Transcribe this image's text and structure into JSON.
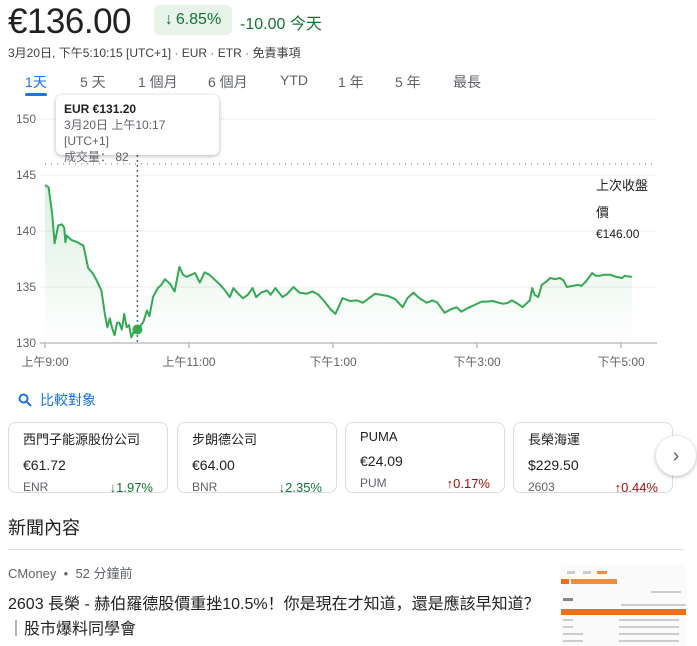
{
  "header": {
    "price": "€136.00",
    "change_pct": "6.85%",
    "change_abs": "-10.00",
    "change_period": "今天",
    "arrow_icon": "arrow-down-icon",
    "timestamp": "3月20日, 下午5:10:15 [UTC+1]",
    "currency": "EUR",
    "exchange": "ETR",
    "disclaimer": "免責事項"
  },
  "tabs": [
    "1天",
    "5 天",
    "1 個月",
    "6 個月",
    "YTD",
    "1 年",
    "5 年",
    "最長"
  ],
  "tooltip": {
    "price": "EUR €131.20",
    "time": "3月20日 上午10:17 [UTC+1]",
    "volume_label": "成交量：",
    "volume": "82"
  },
  "prev_close": {
    "label_1": "上次收盤",
    "label_2": "價",
    "value": "€146.00"
  },
  "colors": {
    "up": "#a50e0e",
    "down": "#137333",
    "line": "#34a853",
    "accent": "#1a73e8"
  },
  "chart_data": {
    "type": "line",
    "x_unit": "minutes since 09:00",
    "xlim": [
      0,
      510
    ],
    "ylim": [
      130,
      150
    ],
    "yticks": [
      150,
      145,
      140,
      135,
      130
    ],
    "xticks": [
      {
        "t": 0,
        "label": "上午9:00"
      },
      {
        "t": 120,
        "label": "上午11:00"
      },
      {
        "t": 240,
        "label": "下午1:00"
      },
      {
        "t": 360,
        "label": "下午3:00"
      },
      {
        "t": 480,
        "label": "下午5:00"
      }
    ],
    "previous_close": 146.0,
    "highlight": {
      "t": 77,
      "price": 131.2
    },
    "points": [
      [
        0,
        144.1
      ],
      [
        3,
        143.9
      ],
      [
        6,
        141.5
      ],
      [
        8,
        138.9
      ],
      [
        11,
        140.5
      ],
      [
        14,
        140.6
      ],
      [
        16,
        140.3
      ],
      [
        17,
        139.0
      ],
      [
        18,
        139.6
      ],
      [
        22,
        139.2
      ],
      [
        27,
        139.0
      ],
      [
        32,
        138.7
      ],
      [
        36,
        136.7
      ],
      [
        40,
        136.2
      ],
      [
        43,
        135.6
      ],
      [
        47,
        134.7
      ],
      [
        50,
        132.5
      ],
      [
        52,
        131.4
      ],
      [
        54,
        132.2
      ],
      [
        56,
        131.3
      ],
      [
        58,
        130.7
      ],
      [
        60,
        131.8
      ],
      [
        62,
        131.8
      ],
      [
        64,
        131.2
      ],
      [
        66,
        132.6
      ],
      [
        68,
        131.4
      ],
      [
        70,
        131.6
      ],
      [
        72,
        130.5
      ],
      [
        75,
        131.3
      ],
      [
        77,
        131.2
      ],
      [
        80,
        131.6
      ],
      [
        82,
        131.9
      ],
      [
        85,
        132.9
      ],
      [
        87,
        132.4
      ],
      [
        90,
        134.1
      ],
      [
        94,
        134.9
      ],
      [
        97,
        135.2
      ],
      [
        100,
        135.7
      ],
      [
        104,
        135.3
      ],
      [
        108,
        134.6
      ],
      [
        112,
        136.8
      ],
      [
        115,
        136.1
      ],
      [
        118,
        135.9
      ],
      [
        122,
        136.1
      ],
      [
        125,
        136.25
      ],
      [
        129,
        135.4
      ],
      [
        133,
        136.3
      ],
      [
        137,
        136.1
      ],
      [
        141,
        135.7
      ],
      [
        146,
        135.2
      ],
      [
        150,
        134.7
      ],
      [
        154,
        134.1
      ],
      [
        157,
        134.9
      ],
      [
        161,
        134.4
      ],
      [
        165,
        134.0
      ],
      [
        169,
        134.3
      ],
      [
        173,
        134.9
      ],
      [
        176,
        134.1
      ],
      [
        180,
        134.5
      ],
      [
        185,
        134.7
      ],
      [
        188,
        134.3
      ],
      [
        192,
        134.9
      ],
      [
        195,
        134.5
      ],
      [
        198,
        134.1
      ],
      [
        202,
        134.4
      ],
      [
        207,
        135.0
      ],
      [
        212,
        134.5
      ],
      [
        218,
        134.4
      ],
      [
        223,
        134.6
      ],
      [
        228,
        134.3
      ],
      [
        233,
        133.7
      ],
      [
        238,
        133.0
      ],
      [
        242,
        132.6
      ],
      [
        248,
        134.0
      ],
      [
        254,
        133.75
      ],
      [
        260,
        133.8
      ],
      [
        265,
        133.6
      ],
      [
        270,
        134.0
      ],
      [
        275,
        134.4
      ],
      [
        280,
        134.3
      ],
      [
        286,
        134.2
      ],
      [
        292,
        133.9
      ],
      [
        298,
        133.2
      ],
      [
        302,
        134.0
      ],
      [
        307,
        134.5
      ],
      [
        312,
        134.0
      ],
      [
        318,
        133.6
      ],
      [
        323,
        133.8
      ],
      [
        327,
        133.6
      ],
      [
        333,
        132.7
      ],
      [
        338,
        133.0
      ],
      [
        343,
        133.2
      ],
      [
        347,
        132.8
      ],
      [
        352,
        133.1
      ],
      [
        358,
        133.4
      ],
      [
        364,
        133.7
      ],
      [
        368,
        133.7
      ],
      [
        373,
        133.75
      ],
      [
        378,
        133.6
      ],
      [
        382,
        133.5
      ],
      [
        386,
        133.6
      ],
      [
        389,
        133.8
      ],
      [
        394,
        133.5
      ],
      [
        398,
        133.2
      ],
      [
        404,
        133.8
      ],
      [
        406,
        134.9
      ],
      [
        408,
        134.3
      ],
      [
        411,
        134.1
      ],
      [
        414,
        135.2
      ],
      [
        418,
        135.5
      ],
      [
        421,
        135.8
      ],
      [
        425,
        135.7
      ],
      [
        429,
        135.8
      ],
      [
        432,
        135.6
      ],
      [
        435,
        135.0
      ],
      [
        440,
        135.1
      ],
      [
        444,
        135.2
      ],
      [
        447,
        135.1
      ],
      [
        450,
        135.4
      ],
      [
        453,
        135.8
      ],
      [
        456,
        136.25
      ],
      [
        459,
        136.0
      ],
      [
        462,
        136.0
      ],
      [
        466,
        136.1
      ],
      [
        471,
        136.1
      ],
      [
        476,
        135.9
      ],
      [
        481,
        135.8
      ],
      [
        483,
        136.0
      ],
      [
        486,
        135.95
      ],
      [
        489,
        135.9
      ]
    ]
  },
  "compare": {
    "label": "比較對象",
    "icon": "search-icon"
  },
  "cards": [
    {
      "name": "西門子能源股份公司",
      "price": "€61.72",
      "ticker": "ENR",
      "change": "1.97%",
      "dir": "down"
    },
    {
      "name": "步朗德公司",
      "price": "€64.00",
      "ticker": "BNR",
      "change": "2.35%",
      "dir": "down"
    },
    {
      "name": "PUMA",
      "price": "€24.09",
      "ticker": "PUM",
      "change": "0.17%",
      "dir": "up"
    },
    {
      "name": "長榮海運",
      "price": "$229.50",
      "ticker": "2603",
      "change": "0.44%",
      "dir": "up"
    }
  ],
  "news": {
    "heading": "新聞內容",
    "source": "CMoney",
    "dot": "•",
    "age": "52 分鐘前",
    "headline": "2603 長榮 - 赫伯羅德股價重挫10.5%！你是現在才知道，還是應該早知道？｜股市爆料同學會"
  }
}
